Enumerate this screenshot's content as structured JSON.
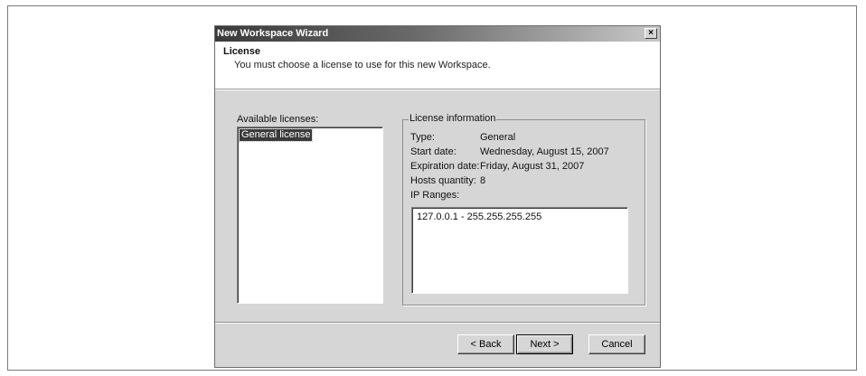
{
  "dialog": {
    "title": "New Workspace Wizard",
    "close_symbol": "×"
  },
  "header": {
    "title": "License",
    "subtitle": "You must choose a license to use for this new Workspace."
  },
  "licenses": {
    "label": "Available licenses:",
    "items": [
      "General license"
    ],
    "selected": "General license"
  },
  "license_info": {
    "legend": "License information",
    "type_label": "Type:",
    "type_value": "General",
    "start_label": "Start date:",
    "start_value": "Wednesday, August 15, 2007",
    "expiration_label": "Expiration date:",
    "expiration_value": "Friday, August 31, 2007",
    "hosts_label": "Hosts quantity:",
    "hosts_value": "8",
    "ip_label": "IP Ranges:",
    "ip_ranges": [
      "127.0.0.1 - 255.255.255.255"
    ]
  },
  "buttons": {
    "back": "< Back",
    "next": "Next >",
    "cancel": "Cancel"
  }
}
